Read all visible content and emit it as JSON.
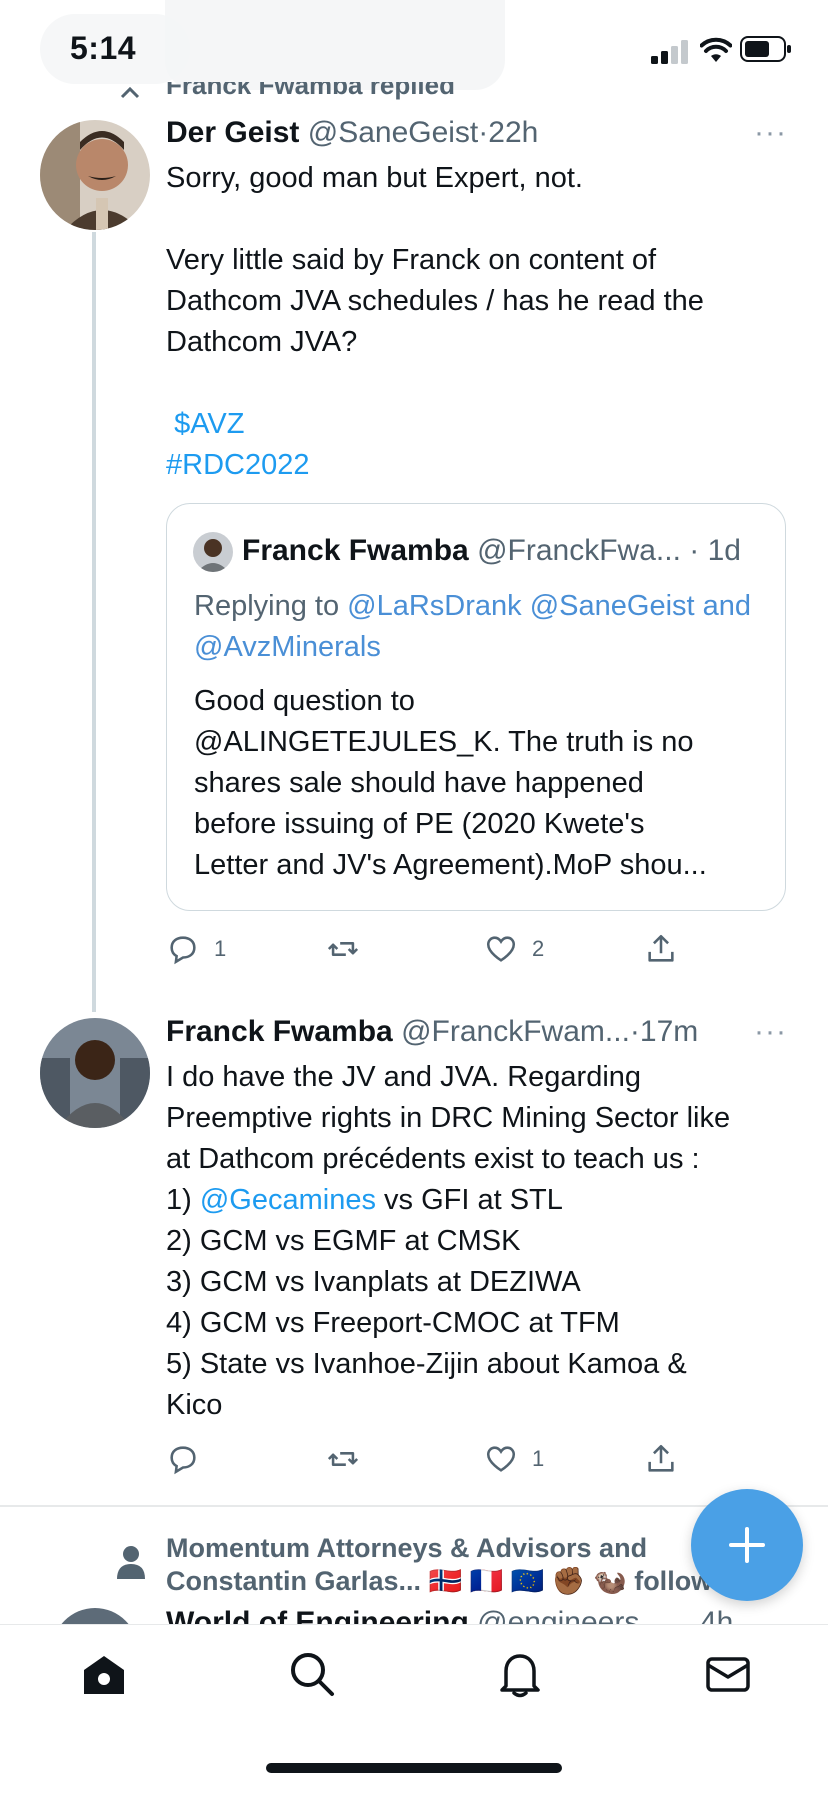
{
  "status_bar": {
    "time": "5:14"
  },
  "thread": {
    "replied_label": "Franck Fwamba replied"
  },
  "tweet1": {
    "name": "Der Geist",
    "handle": "@SaneGeist",
    "separator": "·",
    "age": "22h",
    "more": "···",
    "text_plain": "Sorry, good man but Expert, not.\n\nVery little said by Franck on content of\nDathcom JVA schedules / has he read the\nDathcom JVA?\n\n",
    "cashtag": " $AVZ",
    "hashtag": "#RDC2022",
    "quote": {
      "name": "Franck Fwamba",
      "handle": "@FranckFwa...",
      "separator": "·",
      "age": "1d",
      "replying_prefix": "Replying to ",
      "mention1": "@LaRsDrank",
      "mention2": "@SaneGeist",
      "replying_and": "and",
      "mention3": "@AvzMinerals",
      "text": "Good question to\n@ALINGETEJULES_K. The truth is no\nshares sale should have happened\nbefore issuing of PE (2020 Kwete's\nLetter and JV's Agreement).MoP shou..."
    },
    "actions": {
      "reply_count": "1",
      "retweet_count": "",
      "like_count": "2"
    }
  },
  "tweet2": {
    "name": "Franck Fwamba",
    "handle": "@FranckFwam...",
    "separator": "·",
    "age": "17m",
    "more": "···",
    "text_line1": "I do have the JV and JVA. Regarding\nPreemptive rights in DRC Mining Sector like\nat Dathcom précédents exist to teach us :\n1) ",
    "mention": "@Gecamines",
    "text_line2": " vs GFI at STL\n2) GCM vs EGMF at CMSK\n3) GCM vs Ivanplats at DEZIWA\n4) GCM vs Freeport-CMOC at TFM\n5) State vs Ivanhoe-Zijin about Kamoa &\nKico",
    "actions": {
      "reply_count": "",
      "retweet_count": "",
      "like_count": "1"
    }
  },
  "follow_suggestion": {
    "line1": "Momentum Attorneys & Advisors and",
    "line2": "Constantin Garlas...",
    "emojis": "🇳🇴 🇫🇷 🇪🇺 ✊🏾 🦦",
    "follow": "follow"
  },
  "next_tweet_peek": {
    "name": "World of Engineering",
    "handle": "@engineers_...",
    "age": "4h"
  },
  "colors": {
    "accent": "#1d9bf0",
    "fab": "#4aa0e6",
    "secondary_text": "#536471"
  },
  "bottom_nav": {
    "items": [
      "home-icon",
      "search-icon",
      "notifications-icon",
      "messages-icon"
    ]
  }
}
